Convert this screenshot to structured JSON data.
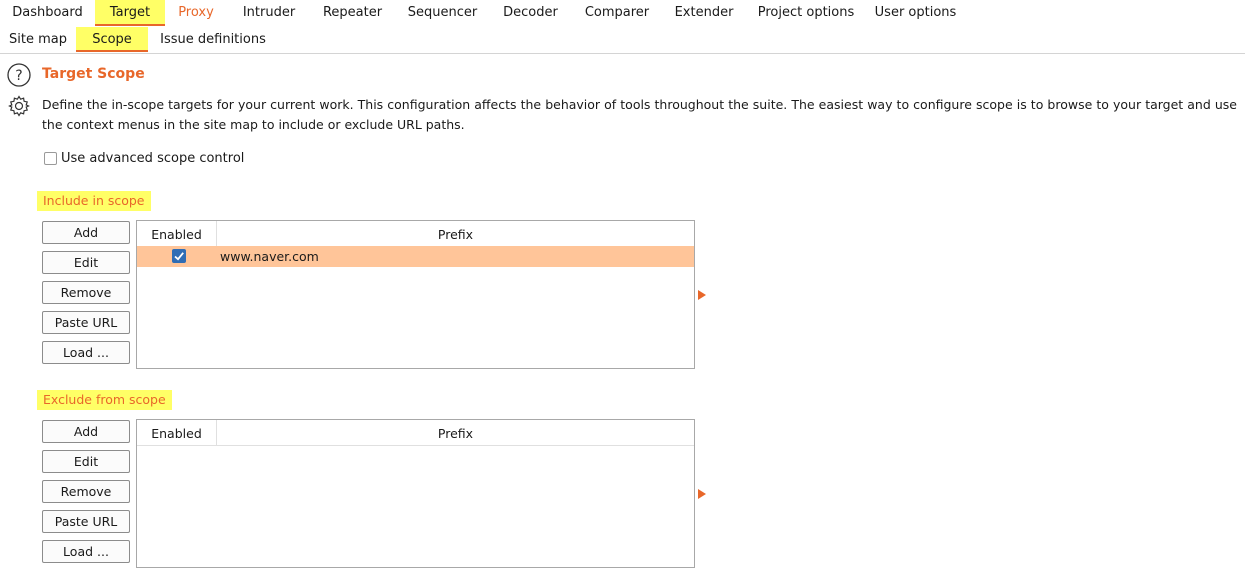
{
  "main_tabs": [
    "Dashboard",
    "Target",
    "Proxy",
    "Intruder",
    "Repeater",
    "Sequencer",
    "Decoder",
    "Comparer",
    "Extender",
    "Project options",
    "User options"
  ],
  "sub_tabs": [
    "Site map",
    "Scope",
    "Issue definitions"
  ],
  "panel": {
    "title": "Target Scope",
    "description": "Define the in-scope targets for your current work. This configuration affects the behavior of tools throughout the suite. The easiest way to configure scope is to browse to your target and use the context menus in the site map to include or exclude URL paths.",
    "advanced_label": "Use advanced scope control"
  },
  "include": {
    "label": "Include in scope",
    "buttons": [
      "Add",
      "Edit",
      "Remove",
      "Paste URL",
      "Load ..."
    ],
    "columns": [
      "Enabled",
      "Prefix"
    ],
    "rows": [
      {
        "enabled": true,
        "prefix": "www.naver.com"
      }
    ]
  },
  "exclude": {
    "label": "Exclude from scope",
    "buttons": [
      "Add",
      "Edit",
      "Remove",
      "Paste URL",
      "Load ..."
    ],
    "columns": [
      "Enabled",
      "Prefix"
    ],
    "rows": []
  },
  "colors": {
    "accent": "#e8672a",
    "highlight": "#ffff66",
    "selected_row": "#ffc599",
    "checkbox": "#2f6db5"
  },
  "icons": [
    "help-icon",
    "gear-icon",
    "check-icon",
    "expand-arrow-icon"
  ]
}
